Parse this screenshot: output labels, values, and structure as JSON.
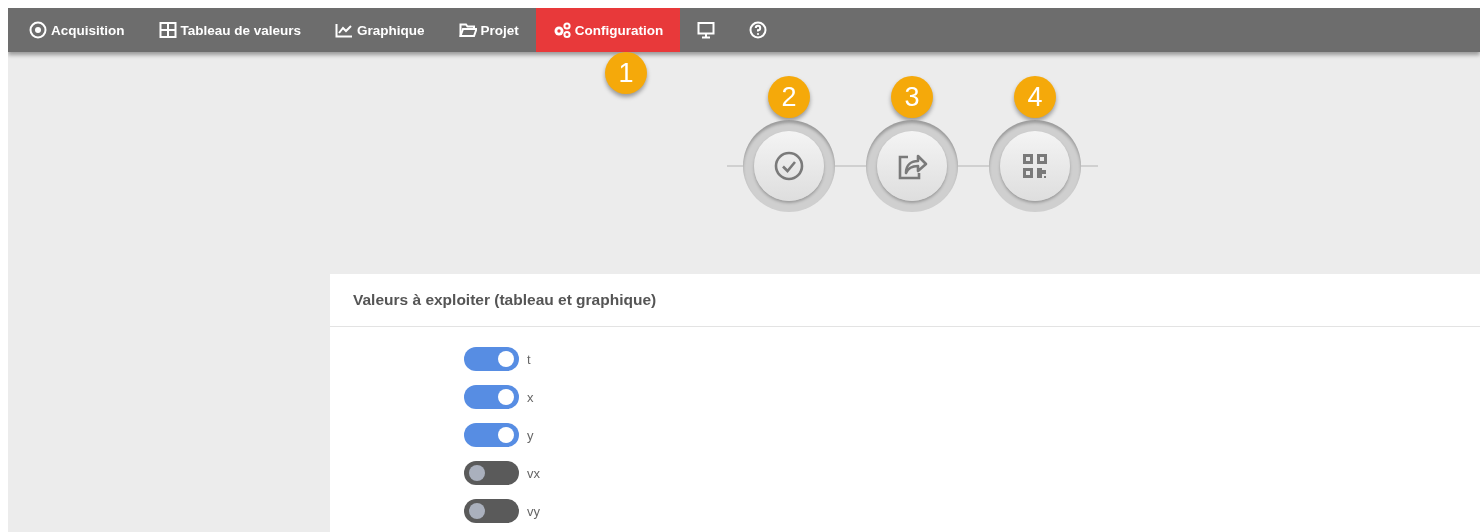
{
  "nav": {
    "items": [
      {
        "label": "Acquisition",
        "selected": false
      },
      {
        "label": "Tableau de valeurs",
        "selected": false
      },
      {
        "label": "Graphique",
        "selected": false
      },
      {
        "label": "Projet",
        "selected": false
      },
      {
        "label": "Configuration",
        "selected": true,
        "callout": "1"
      },
      {
        "selected": false
      },
      {
        "selected": false
      }
    ]
  },
  "steps": [
    {
      "callout": "2"
    },
    {
      "callout": "3"
    },
    {
      "callout": "4"
    }
  ],
  "panel": {
    "title": "Valeurs à exploiter (tableau et graphique)",
    "toggles": [
      {
        "label": "t",
        "on": true
      },
      {
        "label": "x",
        "on": true
      },
      {
        "label": "y",
        "on": true
      },
      {
        "label": "vx",
        "on": false
      },
      {
        "label": "vy",
        "on": false
      }
    ]
  }
}
